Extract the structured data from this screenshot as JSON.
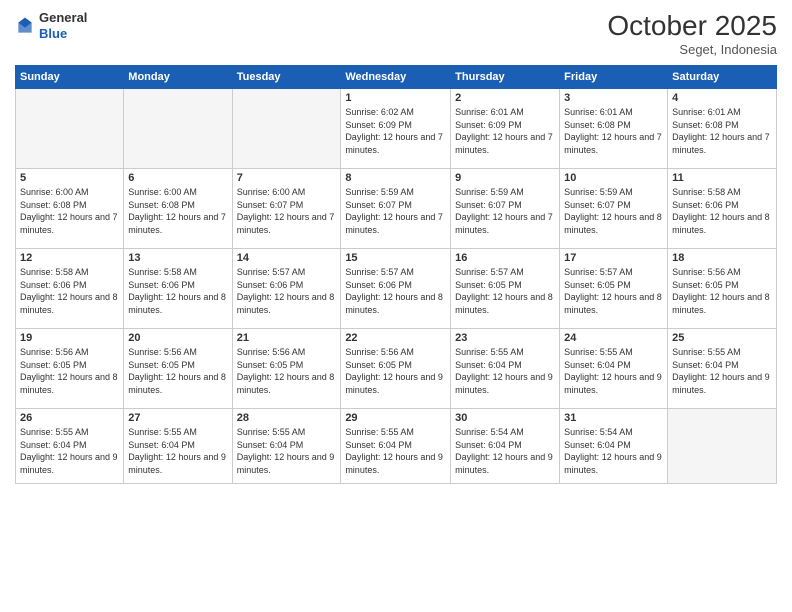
{
  "header": {
    "logo_general": "General",
    "logo_blue": "Blue",
    "month": "October 2025",
    "location": "Seget, Indonesia"
  },
  "weekdays": [
    "Sunday",
    "Monday",
    "Tuesday",
    "Wednesday",
    "Thursday",
    "Friday",
    "Saturday"
  ],
  "weeks": [
    [
      {
        "day": "",
        "sunrise": "",
        "sunset": "",
        "daylight": "",
        "empty": true
      },
      {
        "day": "",
        "sunrise": "",
        "sunset": "",
        "daylight": "",
        "empty": true
      },
      {
        "day": "",
        "sunrise": "",
        "sunset": "",
        "daylight": "",
        "empty": true
      },
      {
        "day": "1",
        "sunrise": "Sunrise: 6:02 AM",
        "sunset": "Sunset: 6:09 PM",
        "daylight": "Daylight: 12 hours and 7 minutes."
      },
      {
        "day": "2",
        "sunrise": "Sunrise: 6:01 AM",
        "sunset": "Sunset: 6:09 PM",
        "daylight": "Daylight: 12 hours and 7 minutes."
      },
      {
        "day": "3",
        "sunrise": "Sunrise: 6:01 AM",
        "sunset": "Sunset: 6:08 PM",
        "daylight": "Daylight: 12 hours and 7 minutes."
      },
      {
        "day": "4",
        "sunrise": "Sunrise: 6:01 AM",
        "sunset": "Sunset: 6:08 PM",
        "daylight": "Daylight: 12 hours and 7 minutes."
      }
    ],
    [
      {
        "day": "5",
        "sunrise": "Sunrise: 6:00 AM",
        "sunset": "Sunset: 6:08 PM",
        "daylight": "Daylight: 12 hours and 7 minutes."
      },
      {
        "day": "6",
        "sunrise": "Sunrise: 6:00 AM",
        "sunset": "Sunset: 6:08 PM",
        "daylight": "Daylight: 12 hours and 7 minutes."
      },
      {
        "day": "7",
        "sunrise": "Sunrise: 6:00 AM",
        "sunset": "Sunset: 6:07 PM",
        "daylight": "Daylight: 12 hours and 7 minutes."
      },
      {
        "day": "8",
        "sunrise": "Sunrise: 5:59 AM",
        "sunset": "Sunset: 6:07 PM",
        "daylight": "Daylight: 12 hours and 7 minutes."
      },
      {
        "day": "9",
        "sunrise": "Sunrise: 5:59 AM",
        "sunset": "Sunset: 6:07 PM",
        "daylight": "Daylight: 12 hours and 7 minutes."
      },
      {
        "day": "10",
        "sunrise": "Sunrise: 5:59 AM",
        "sunset": "Sunset: 6:07 PM",
        "daylight": "Daylight: 12 hours and 8 minutes."
      },
      {
        "day": "11",
        "sunrise": "Sunrise: 5:58 AM",
        "sunset": "Sunset: 6:06 PM",
        "daylight": "Daylight: 12 hours and 8 minutes."
      }
    ],
    [
      {
        "day": "12",
        "sunrise": "Sunrise: 5:58 AM",
        "sunset": "Sunset: 6:06 PM",
        "daylight": "Daylight: 12 hours and 8 minutes."
      },
      {
        "day": "13",
        "sunrise": "Sunrise: 5:58 AM",
        "sunset": "Sunset: 6:06 PM",
        "daylight": "Daylight: 12 hours and 8 minutes."
      },
      {
        "day": "14",
        "sunrise": "Sunrise: 5:57 AM",
        "sunset": "Sunset: 6:06 PM",
        "daylight": "Daylight: 12 hours and 8 minutes."
      },
      {
        "day": "15",
        "sunrise": "Sunrise: 5:57 AM",
        "sunset": "Sunset: 6:06 PM",
        "daylight": "Daylight: 12 hours and 8 minutes."
      },
      {
        "day": "16",
        "sunrise": "Sunrise: 5:57 AM",
        "sunset": "Sunset: 6:05 PM",
        "daylight": "Daylight: 12 hours and 8 minutes."
      },
      {
        "day": "17",
        "sunrise": "Sunrise: 5:57 AM",
        "sunset": "Sunset: 6:05 PM",
        "daylight": "Daylight: 12 hours and 8 minutes."
      },
      {
        "day": "18",
        "sunrise": "Sunrise: 5:56 AM",
        "sunset": "Sunset: 6:05 PM",
        "daylight": "Daylight: 12 hours and 8 minutes."
      }
    ],
    [
      {
        "day": "19",
        "sunrise": "Sunrise: 5:56 AM",
        "sunset": "Sunset: 6:05 PM",
        "daylight": "Daylight: 12 hours and 8 minutes."
      },
      {
        "day": "20",
        "sunrise": "Sunrise: 5:56 AM",
        "sunset": "Sunset: 6:05 PM",
        "daylight": "Daylight: 12 hours and 8 minutes."
      },
      {
        "day": "21",
        "sunrise": "Sunrise: 5:56 AM",
        "sunset": "Sunset: 6:05 PM",
        "daylight": "Daylight: 12 hours and 8 minutes."
      },
      {
        "day": "22",
        "sunrise": "Sunrise: 5:56 AM",
        "sunset": "Sunset: 6:05 PM",
        "daylight": "Daylight: 12 hours and 9 minutes."
      },
      {
        "day": "23",
        "sunrise": "Sunrise: 5:55 AM",
        "sunset": "Sunset: 6:04 PM",
        "daylight": "Daylight: 12 hours and 9 minutes."
      },
      {
        "day": "24",
        "sunrise": "Sunrise: 5:55 AM",
        "sunset": "Sunset: 6:04 PM",
        "daylight": "Daylight: 12 hours and 9 minutes."
      },
      {
        "day": "25",
        "sunrise": "Sunrise: 5:55 AM",
        "sunset": "Sunset: 6:04 PM",
        "daylight": "Daylight: 12 hours and 9 minutes."
      }
    ],
    [
      {
        "day": "26",
        "sunrise": "Sunrise: 5:55 AM",
        "sunset": "Sunset: 6:04 PM",
        "daylight": "Daylight: 12 hours and 9 minutes."
      },
      {
        "day": "27",
        "sunrise": "Sunrise: 5:55 AM",
        "sunset": "Sunset: 6:04 PM",
        "daylight": "Daylight: 12 hours and 9 minutes."
      },
      {
        "day": "28",
        "sunrise": "Sunrise: 5:55 AM",
        "sunset": "Sunset: 6:04 PM",
        "daylight": "Daylight: 12 hours and 9 minutes."
      },
      {
        "day": "29",
        "sunrise": "Sunrise: 5:55 AM",
        "sunset": "Sunset: 6:04 PM",
        "daylight": "Daylight: 12 hours and 9 minutes."
      },
      {
        "day": "30",
        "sunrise": "Sunrise: 5:54 AM",
        "sunset": "Sunset: 6:04 PM",
        "daylight": "Daylight: 12 hours and 9 minutes."
      },
      {
        "day": "31",
        "sunrise": "Sunrise: 5:54 AM",
        "sunset": "Sunset: 6:04 PM",
        "daylight": "Daylight: 12 hours and 9 minutes."
      },
      {
        "day": "",
        "sunrise": "",
        "sunset": "",
        "daylight": "",
        "empty": true
      }
    ]
  ]
}
